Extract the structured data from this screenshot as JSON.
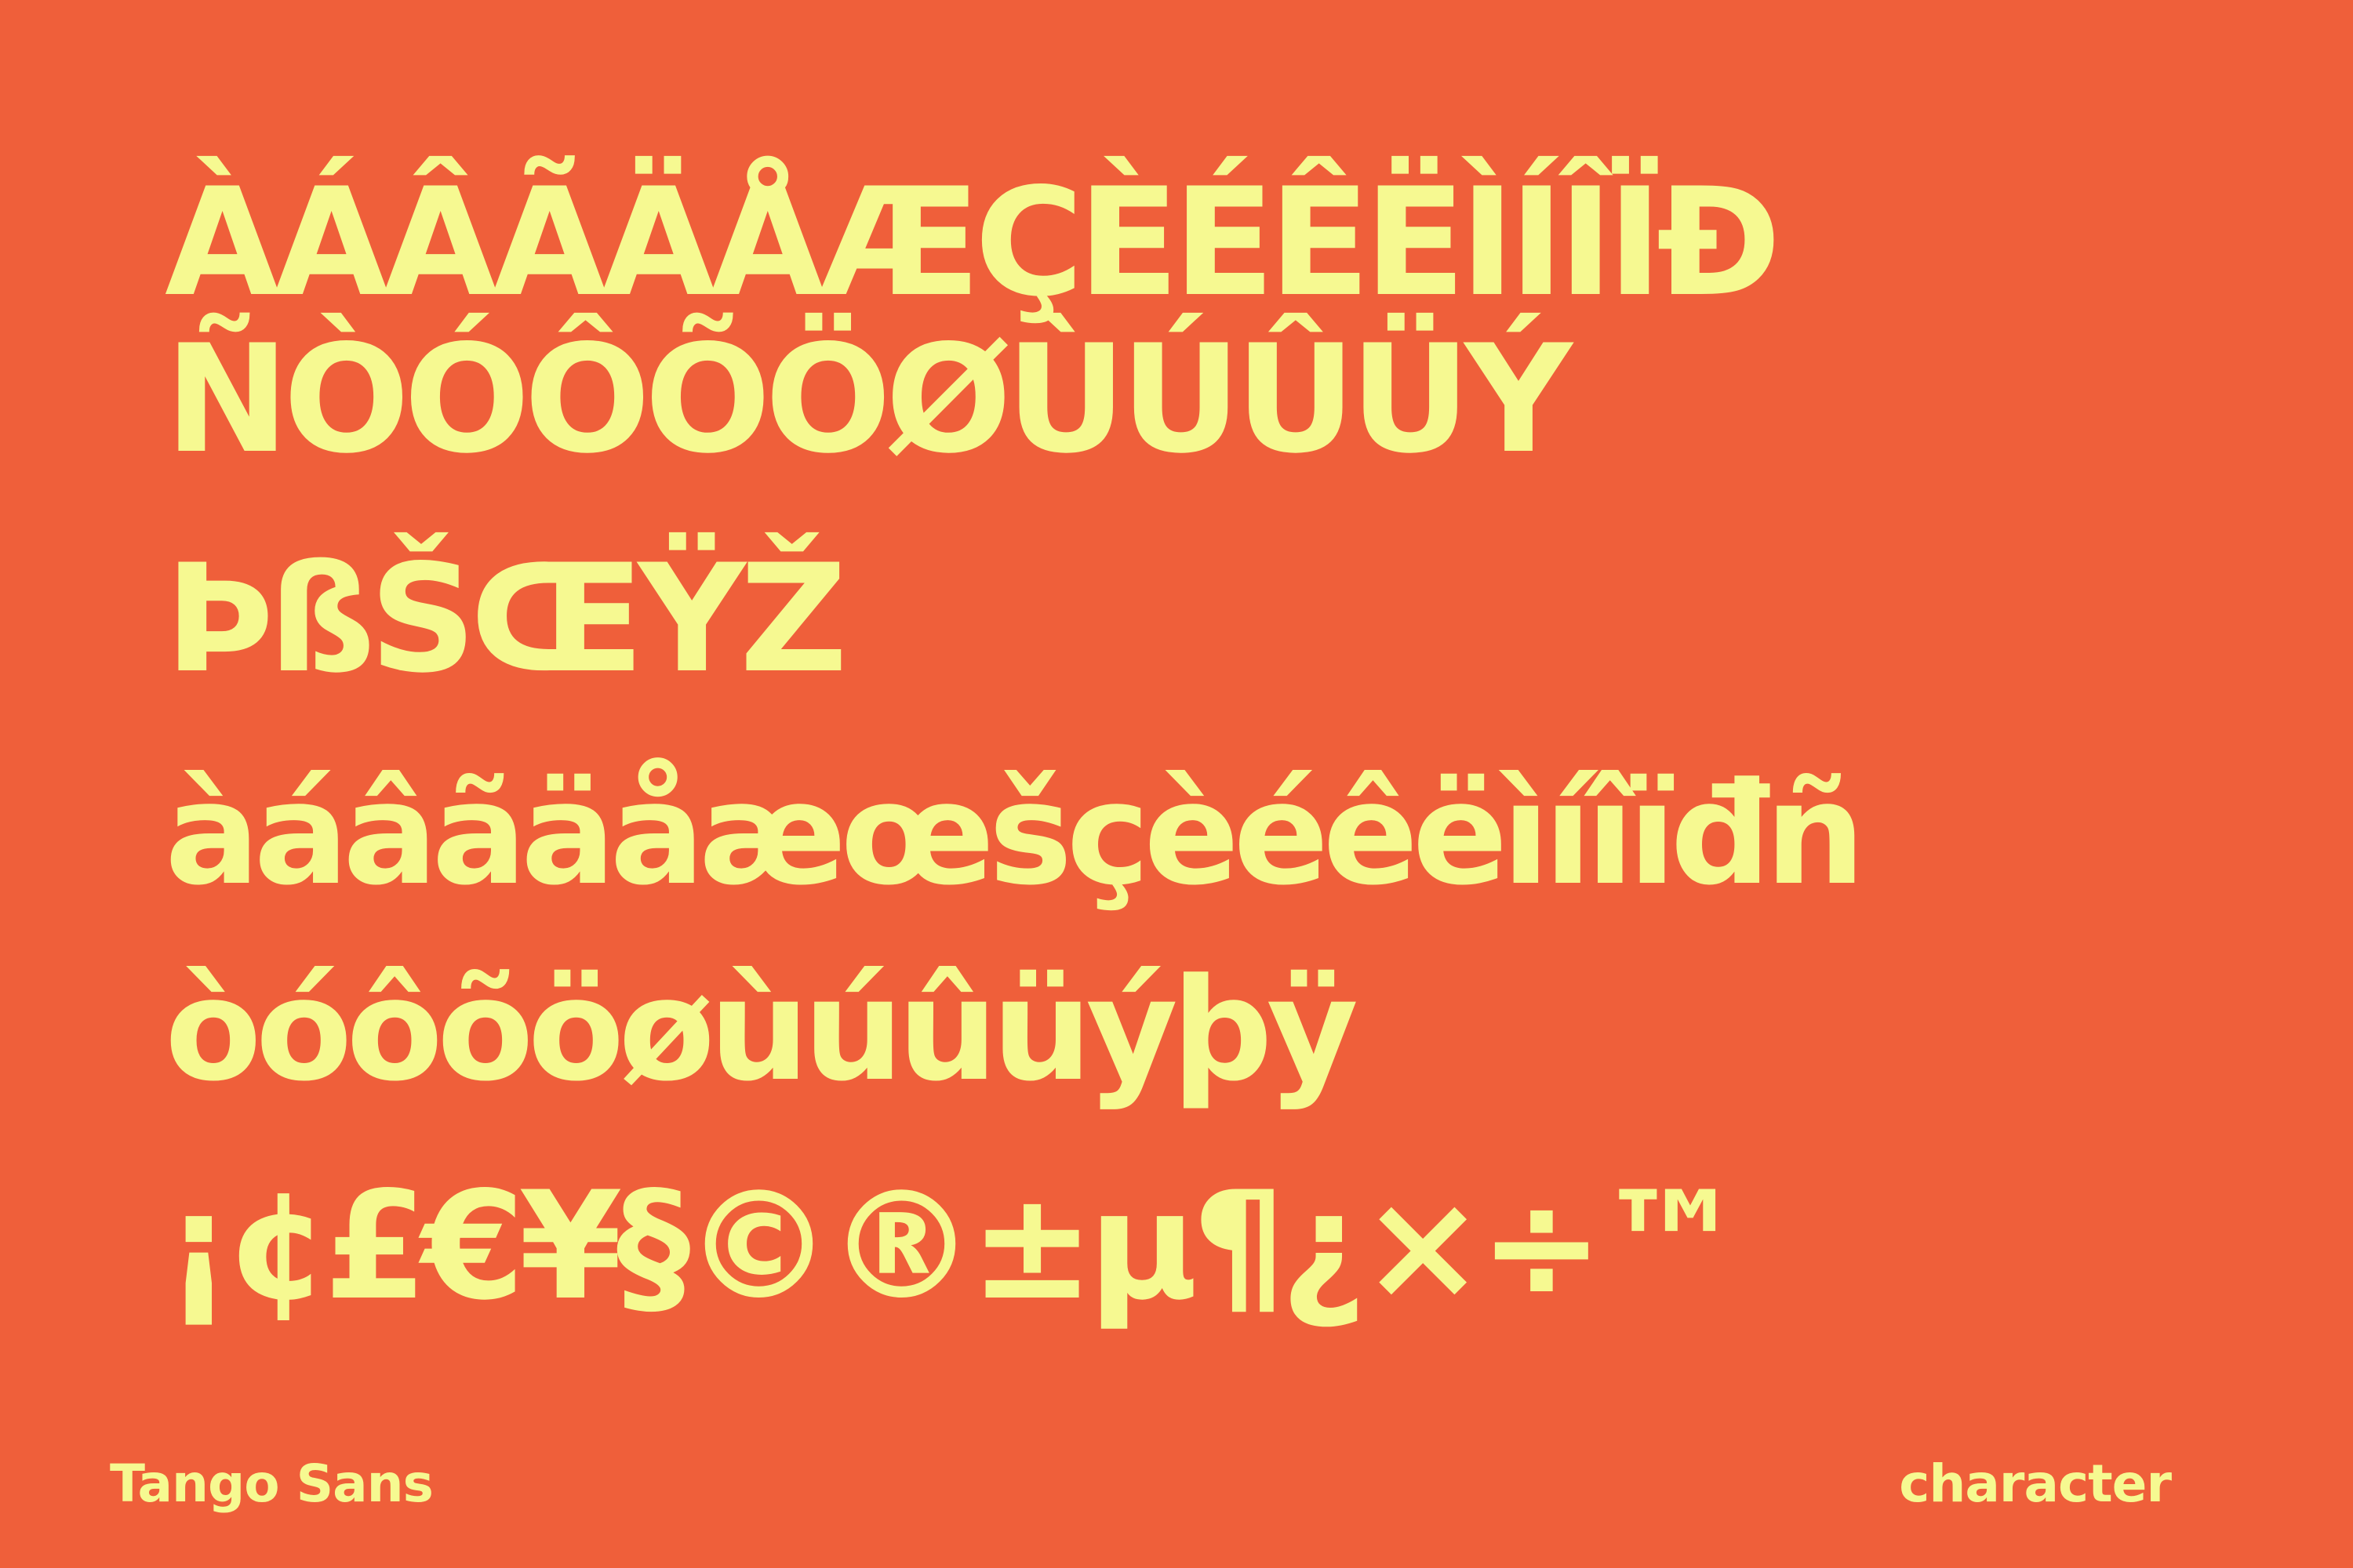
{
  "colors": {
    "background": "#EF5F3A",
    "text": "#F6F991"
  },
  "specimen": {
    "uppercase_lines": [
      "ÀÁÂÃÄÅÆÇÈÉÊËÌÍÎÏÐ",
      "ÑÒÓÔÕÖØÙÚÛÜÝ",
      "ÞßŠŒŸŽ"
    ],
    "lowercase_lines": [
      "àáâãäåæœšçèéêëìíîïđñ",
      "òóôõöøùúûüýþÿ"
    ],
    "symbols_line": "¡¢£€¥§©®±µ¶¿×÷™"
  },
  "footer": {
    "font_name": "Tango Sans",
    "category": "character"
  }
}
